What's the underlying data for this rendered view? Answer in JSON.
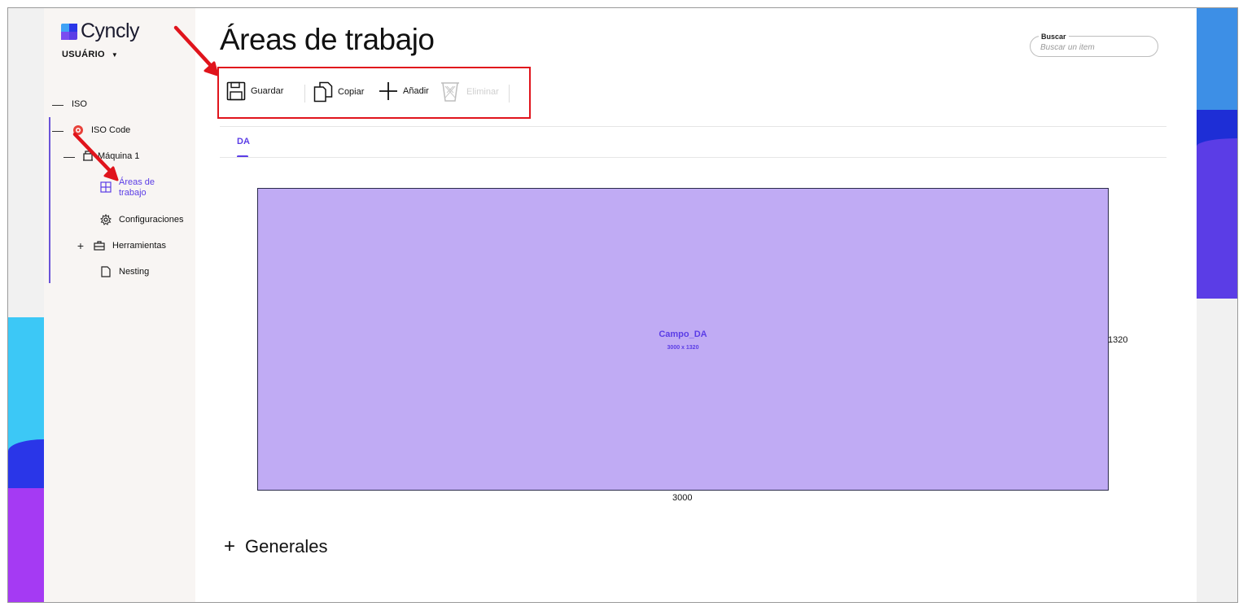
{
  "app": {
    "logo_text": "Cyncly",
    "user_label": "USUÁRIO"
  },
  "sidebar": {
    "items": [
      {
        "toggle": "—",
        "label": "ISO",
        "icon": "minus-icon"
      },
      {
        "toggle": "—",
        "label": "ISO Code",
        "icon": "iso-code-icon"
      },
      {
        "toggle": "—",
        "label": "Máquina 1",
        "icon": "machine-icon"
      },
      {
        "toggle": "",
        "label": "Áreas de trabajo",
        "icon": "grid-icon",
        "active": true
      },
      {
        "toggle": "",
        "label": "Configuraciones",
        "icon": "gear-icon"
      },
      {
        "toggle": "+",
        "label": "Herramientas",
        "icon": "toolbox-icon"
      },
      {
        "toggle": "",
        "label": "Nesting",
        "icon": "document-icon"
      }
    ]
  },
  "header": {
    "title": "Áreas de trabajo",
    "search_label": "Buscar",
    "search_placeholder": "Buscar un item"
  },
  "toolbar": {
    "save_label": "Guardar",
    "copy_label": "Copiar",
    "add_label": "Añadir",
    "delete_label": "Eliminar"
  },
  "tabs": [
    {
      "label": "DA",
      "active": true
    }
  ],
  "work_area": {
    "name": "Campo_DA",
    "dimensions": "3000 x 1320",
    "width_label": "3000",
    "height_label": "1320",
    "fill_color": "#c0abf4"
  },
  "sections": {
    "generales_label": "Generales"
  },
  "colors": {
    "accent": "#5b3de6",
    "annotation": "#e0141c"
  }
}
